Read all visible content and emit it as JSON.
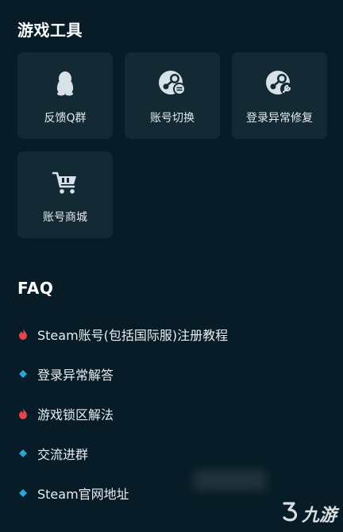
{
  "tools_section": {
    "title": "游戏工具",
    "items": [
      {
        "label": "反馈Q群",
        "icon": "penguin-icon"
      },
      {
        "label": "账号切换",
        "icon": "steam-switch-icon"
      },
      {
        "label": "登录异常修复",
        "icon": "steam-repair-icon"
      },
      {
        "label": "账号商城",
        "icon": "cart-icon"
      }
    ]
  },
  "faq_section": {
    "title": "FAQ",
    "items": [
      {
        "text": "Steam账号(包括国际服)注册教程",
        "bullet": "fire-icon"
      },
      {
        "text": "登录异常解答",
        "bullet": "diamond-icon"
      },
      {
        "text": "游戏锁区解法",
        "bullet": "fire-icon"
      },
      {
        "text": "交流进群",
        "bullet": "diamond-icon"
      },
      {
        "text": "Steam官网地址",
        "bullet": "diamond-icon"
      }
    ]
  },
  "watermark": {
    "text": "九游"
  },
  "colors": {
    "background": "#071c26",
    "card": "#132a34",
    "fire": "#e8434a",
    "diamond": "#2aa7d8"
  }
}
